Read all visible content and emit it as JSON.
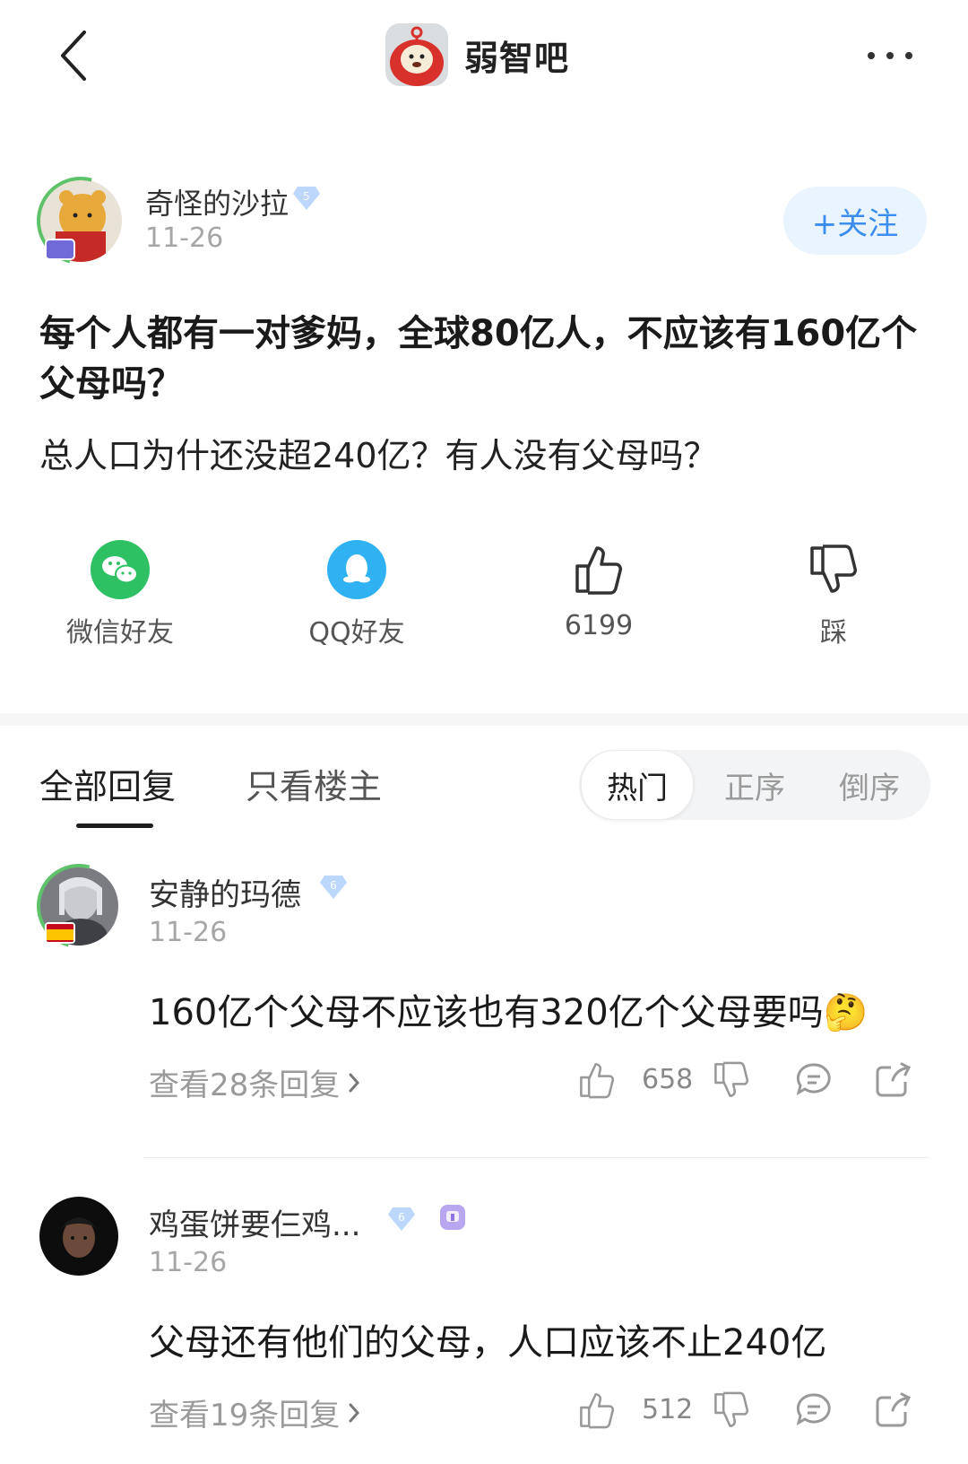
{
  "header": {
    "forum_name": "弱智吧"
  },
  "author": {
    "name": "奇怪的沙拉",
    "level": "5",
    "date": "11-26",
    "follow_label": "+关注"
  },
  "post": {
    "title": "每个人都有一对爹妈，全球80亿人，不应该有160亿个父母吗？",
    "body": "总人口为什还没超240亿？有人没有父母吗？"
  },
  "actions": {
    "wechat_label": "微信好友",
    "qq_label": "QQ好友",
    "like_count": "6199",
    "dislike_label": "踩"
  },
  "tabs": {
    "all": "全部回复",
    "op_only": "只看楼主",
    "sort": [
      "热门",
      "正序",
      "倒序"
    ]
  },
  "comments": [
    {
      "name": "安静的玛德",
      "level": "6",
      "date": "11-26",
      "text": "160亿个父母不应该也有320亿个父母要吗",
      "emoji": "🤔",
      "replies": "查看28条回复",
      "likes": "658"
    },
    {
      "name": "鸡蛋饼要仨鸡...",
      "level": "6",
      "date": "11-26",
      "text": "父母还有他们的父母，人口应该不止240亿",
      "replies": "查看19条回复",
      "likes": "512"
    }
  ],
  "colors": {
    "accent_blue": "#3b8ef0",
    "wechat_green": "#2dc164",
    "qq_blue": "#2fb1f2"
  }
}
